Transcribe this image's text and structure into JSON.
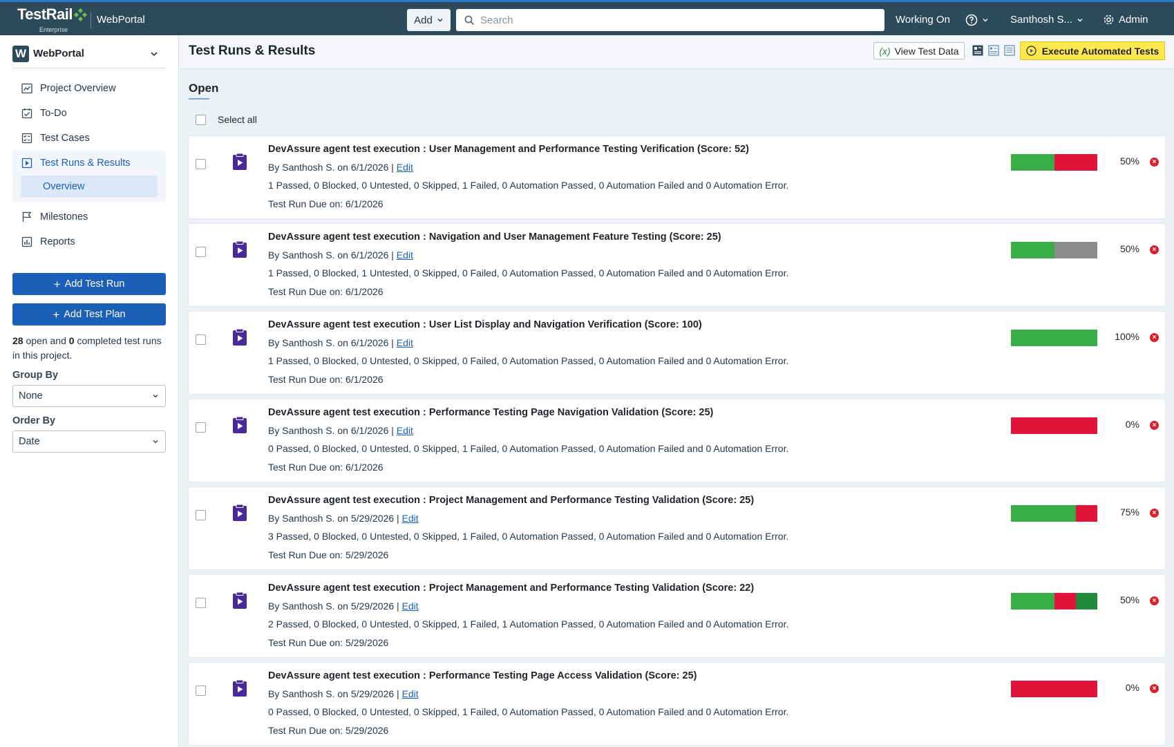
{
  "header": {
    "brand": "TestRail",
    "edition": "Enterprise",
    "project": "WebPortal",
    "add_label": "Add",
    "search_placeholder": "Search",
    "working_on": "Working On",
    "user": "Santhosh S...",
    "admin": "Admin"
  },
  "sidebar": {
    "project_badge": "W",
    "project_name": "WebPortal",
    "items": [
      {
        "label": "Project Overview",
        "icon": "chart-icon"
      },
      {
        "label": "To-Do",
        "icon": "todo-icon"
      },
      {
        "label": "Test Cases",
        "icon": "test-cases-icon"
      },
      {
        "label": "Test Runs & Results",
        "icon": "play-icon"
      },
      {
        "label": "Milestones",
        "icon": "flag-icon"
      },
      {
        "label": "Reports",
        "icon": "reports-icon"
      }
    ],
    "sub_item": "Overview",
    "add_run": "Add Test Run",
    "add_plan": "Add Test Plan",
    "summary": {
      "open_count": "28",
      "open_text": "open and",
      "completed_count": "0",
      "completed_text": "completed test runs in this project."
    },
    "group_by": {
      "label": "Group By",
      "value": "None"
    },
    "order_by": {
      "label": "Order By",
      "value": "Date"
    }
  },
  "main": {
    "title": "Test Runs & Results",
    "view_test_data": "View Test Data",
    "execute": "Execute Automated Tests",
    "section": "Open",
    "select_all": "Select all"
  },
  "runs": [
    {
      "title": "DevAssure agent test execution : User Management and Performance Testing Verification (Score: 52)",
      "by": "By Santhosh S. on 6/1/2026 |",
      "edit": "Edit",
      "stats": "1 Passed, 0 Blocked, 0 Untested, 0 Skipped, 1 Failed, 0 Automation Passed, 0 Automation Failed and 0 Automation Error.",
      "due": "Test Run Due on: 6/1/2026",
      "percent": "50%",
      "segments": [
        {
          "color": "#3aad48",
          "fraction": 0.5
        },
        {
          "color": "#e3143c",
          "fraction": 0.5
        }
      ]
    },
    {
      "title": "DevAssure agent test execution : Navigation and User Management Feature Testing (Score: 25)",
      "by": "By Santhosh S. on 6/1/2026 |",
      "edit": "Edit",
      "stats": "1 Passed, 0 Blocked, 1 Untested, 0 Skipped, 0 Failed, 0 Automation Passed, 0 Automation Failed and 0 Automation Error.",
      "due": "Test Run Due on: 6/1/2026",
      "percent": "50%",
      "segments": [
        {
          "color": "#3aad48",
          "fraction": 0.5
        },
        {
          "color": "#8c8c8c",
          "fraction": 0.5
        }
      ]
    },
    {
      "title": "DevAssure agent test execution : User List Display and Navigation Verification (Score: 100)",
      "by": "By Santhosh S. on 6/1/2026 |",
      "edit": "Edit",
      "stats": "1 Passed, 0 Blocked, 0 Untested, 0 Skipped, 0 Failed, 0 Automation Passed, 0 Automation Failed and 0 Automation Error.",
      "due": "Test Run Due on: 6/1/2026",
      "percent": "100%",
      "segments": [
        {
          "color": "#3aad48",
          "fraction": 1.0
        }
      ]
    },
    {
      "title": "DevAssure agent test execution : Performance Testing Page Navigation Validation (Score: 25)",
      "by": "By Santhosh S. on 6/1/2026 |",
      "edit": "Edit",
      "stats": "0 Passed, 0 Blocked, 0 Untested, 0 Skipped, 1 Failed, 0 Automation Passed, 0 Automation Failed and 0 Automation Error.",
      "due": "Test Run Due on: 6/1/2026",
      "percent": "0%",
      "segments": [
        {
          "color": "#e3143c",
          "fraction": 1.0
        }
      ]
    },
    {
      "title": "DevAssure agent test execution : Project Management and Performance Testing Validation (Score: 25)",
      "by": "By Santhosh S. on 5/29/2026 |",
      "edit": "Edit",
      "stats": "3 Passed, 0 Blocked, 0 Untested, 0 Skipped, 1 Failed, 0 Automation Passed, 0 Automation Failed and 0 Automation Error.",
      "due": "Test Run Due on: 5/29/2026",
      "percent": "75%",
      "segments": [
        {
          "color": "#3aad48",
          "fraction": 0.75
        },
        {
          "color": "#e3143c",
          "fraction": 0.25
        }
      ]
    },
    {
      "title": "DevAssure agent test execution : Project Management and Performance Testing Validation (Score: 22)",
      "by": "By Santhosh S. on 5/29/2026 |",
      "edit": "Edit",
      "stats": "2 Passed, 0 Blocked, 0 Untested, 0 Skipped, 1 Failed, 1 Automation Passed, 0 Automation Failed and 0 Automation Error.",
      "due": "Test Run Due on: 5/29/2026",
      "percent": "50%",
      "segments": [
        {
          "color": "#3aad48",
          "fraction": 0.5
        },
        {
          "color": "#e3143c",
          "fraction": 0.25
        },
        {
          "color": "#1e8a3a",
          "fraction": 0.25
        }
      ]
    },
    {
      "title": "DevAssure agent test execution : Performance Testing Page Access Validation (Score: 25)",
      "by": "By Santhosh S. on 5/29/2026 |",
      "edit": "Edit",
      "stats": "0 Passed, 0 Blocked, 0 Untested, 0 Skipped, 1 Failed, 0 Automation Passed, 0 Automation Failed and 0 Automation Error.",
      "due": "Test Run Due on: 5/29/2026",
      "percent": "0%",
      "segments": [
        {
          "color": "#e3143c",
          "fraction": 1.0
        }
      ]
    }
  ]
}
